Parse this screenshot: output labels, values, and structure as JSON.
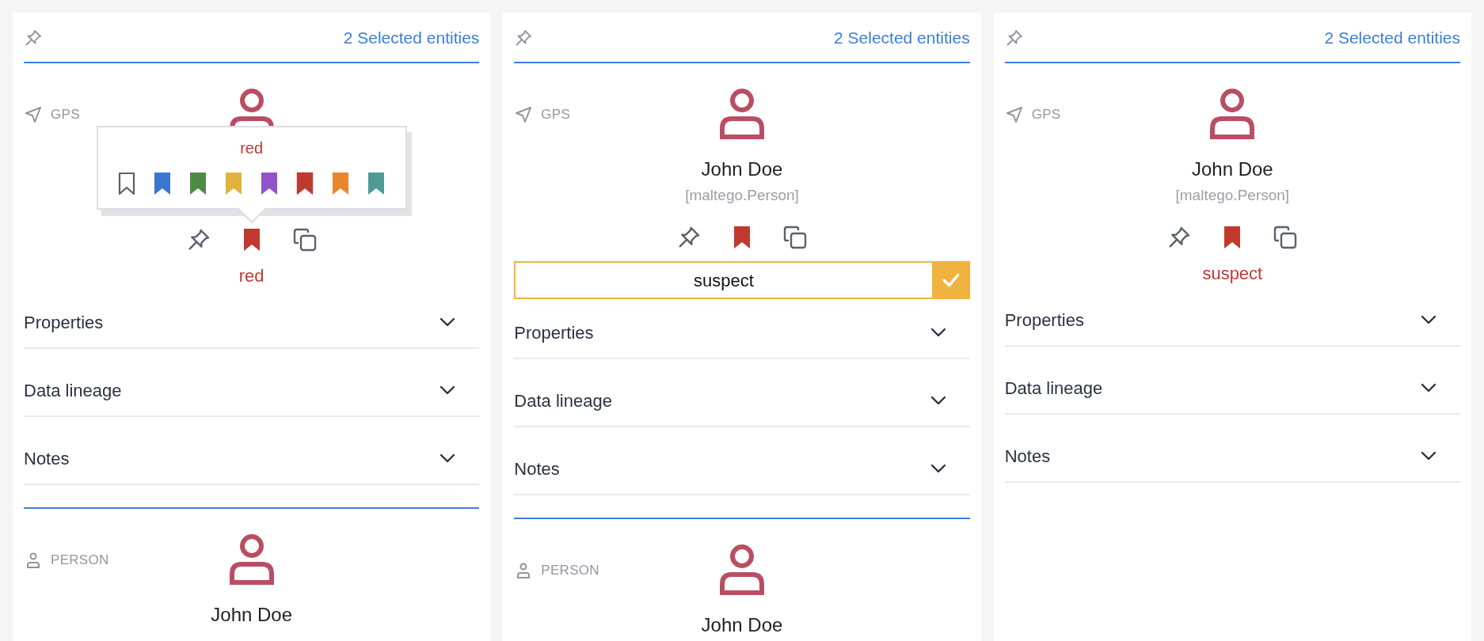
{
  "panels": [
    {
      "header": {
        "count_link": "2 Selected entities"
      },
      "entities": [
        {
          "kind": "gps",
          "type_label": "GPS",
          "color": "#c0392f",
          "popover": {
            "title": "red",
            "options": [
              {
                "kind": "none",
                "selected": false
              },
              {
                "kind": "color",
                "color": "#3a76d0",
                "selected": false
              },
              {
                "kind": "color",
                "color": "#4e8b44",
                "selected": false
              },
              {
                "kind": "color",
                "color": "#e0b43c",
                "selected": false
              },
              {
                "kind": "color",
                "color": "#9352c8",
                "selected": false
              },
              {
                "kind": "color",
                "color": "#c0392f",
                "selected": true
              },
              {
                "kind": "color",
                "color": "#e8862e",
                "selected": false
              },
              {
                "kind": "color",
                "color": "#4f9a97",
                "selected": false
              }
            ]
          },
          "tag": {
            "kind": "label",
            "text": "red"
          },
          "sections": [
            {
              "title": "Properties",
              "expanded": false
            },
            {
              "title": "Data lineage",
              "expanded": false
            },
            {
              "title": "Notes",
              "expanded": false
            }
          ]
        },
        {
          "kind": "person",
          "type_label": "PERSON",
          "name": "John Doe"
        }
      ]
    },
    {
      "header": {
        "count_link": "2 Selected entities"
      },
      "entities": [
        {
          "kind": "gps",
          "type_label": "GPS",
          "name": "John Doe",
          "entity_type": "[maltego.Person]",
          "color": "#c0392f",
          "tag": {
            "kind": "input",
            "value": "suspect"
          },
          "sections": [
            {
              "title": "Properties",
              "expanded": false
            },
            {
              "title": "Data lineage",
              "expanded": false
            },
            {
              "title": "Notes",
              "expanded": false
            }
          ]
        },
        {
          "kind": "person",
          "type_label": "PERSON",
          "name": "John Doe"
        }
      ]
    },
    {
      "header": {
        "count_link": "2 Selected entities"
      },
      "entities": [
        {
          "kind": "gps",
          "type_label": "GPS",
          "name": "John Doe",
          "entity_type": "[maltego.Person]",
          "color": "#c0392f",
          "tag": {
            "kind": "label",
            "text": "suspect"
          },
          "sections": [
            {
              "title": "Properties",
              "expanded": false
            },
            {
              "title": "Data lineage",
              "expanded": false
            },
            {
              "title": "Notes",
              "expanded": false
            }
          ]
        }
      ]
    }
  ]
}
